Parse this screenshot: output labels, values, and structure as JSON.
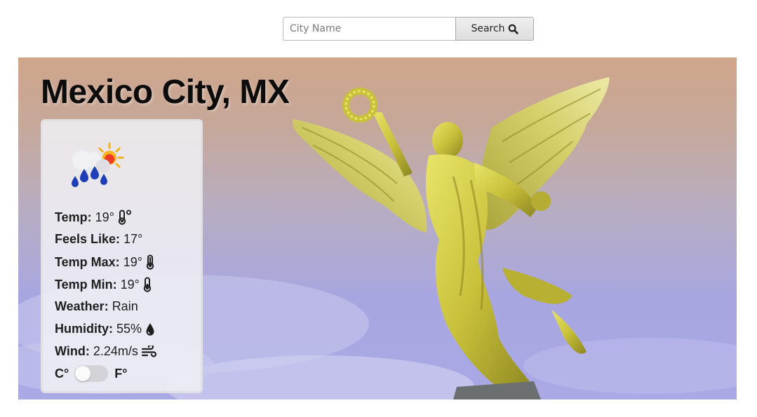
{
  "search": {
    "placeholder": "City Name",
    "value": "",
    "button_label": "Search",
    "button_icon": "search-icon"
  },
  "location": {
    "title": "Mexico City, MX"
  },
  "weather": {
    "icon": "rain-sun-icon",
    "rows": [
      {
        "label": "Temp:",
        "value": "19°",
        "icon": "thermometer-degree-icon"
      },
      {
        "label": "Feels Like:",
        "value": "17°"
      },
      {
        "label": "Temp Max:",
        "value": "19°",
        "icon": "thermometer-full-icon"
      },
      {
        "label": "Temp Min:",
        "value": "19°",
        "icon": "thermometer-low-icon"
      },
      {
        "label": "Weather:",
        "value": "Rain"
      },
      {
        "label": "Humidity:",
        "value": "55%",
        "icon": "droplet-icon"
      },
      {
        "label": "Wind:",
        "value": "2.24m/s",
        "icon": "wind-icon"
      }
    ]
  },
  "units": {
    "celsius_label": "C°",
    "fahrenheit_label": "F°",
    "fahrenheit_selected": false
  },
  "colors": {
    "title": "#0c0c0c",
    "card_background": "#f2f2f6",
    "statue_gold": "#c8c23a",
    "sky_top": "#cfa58a",
    "sky_bottom": "#a9a9e6"
  }
}
